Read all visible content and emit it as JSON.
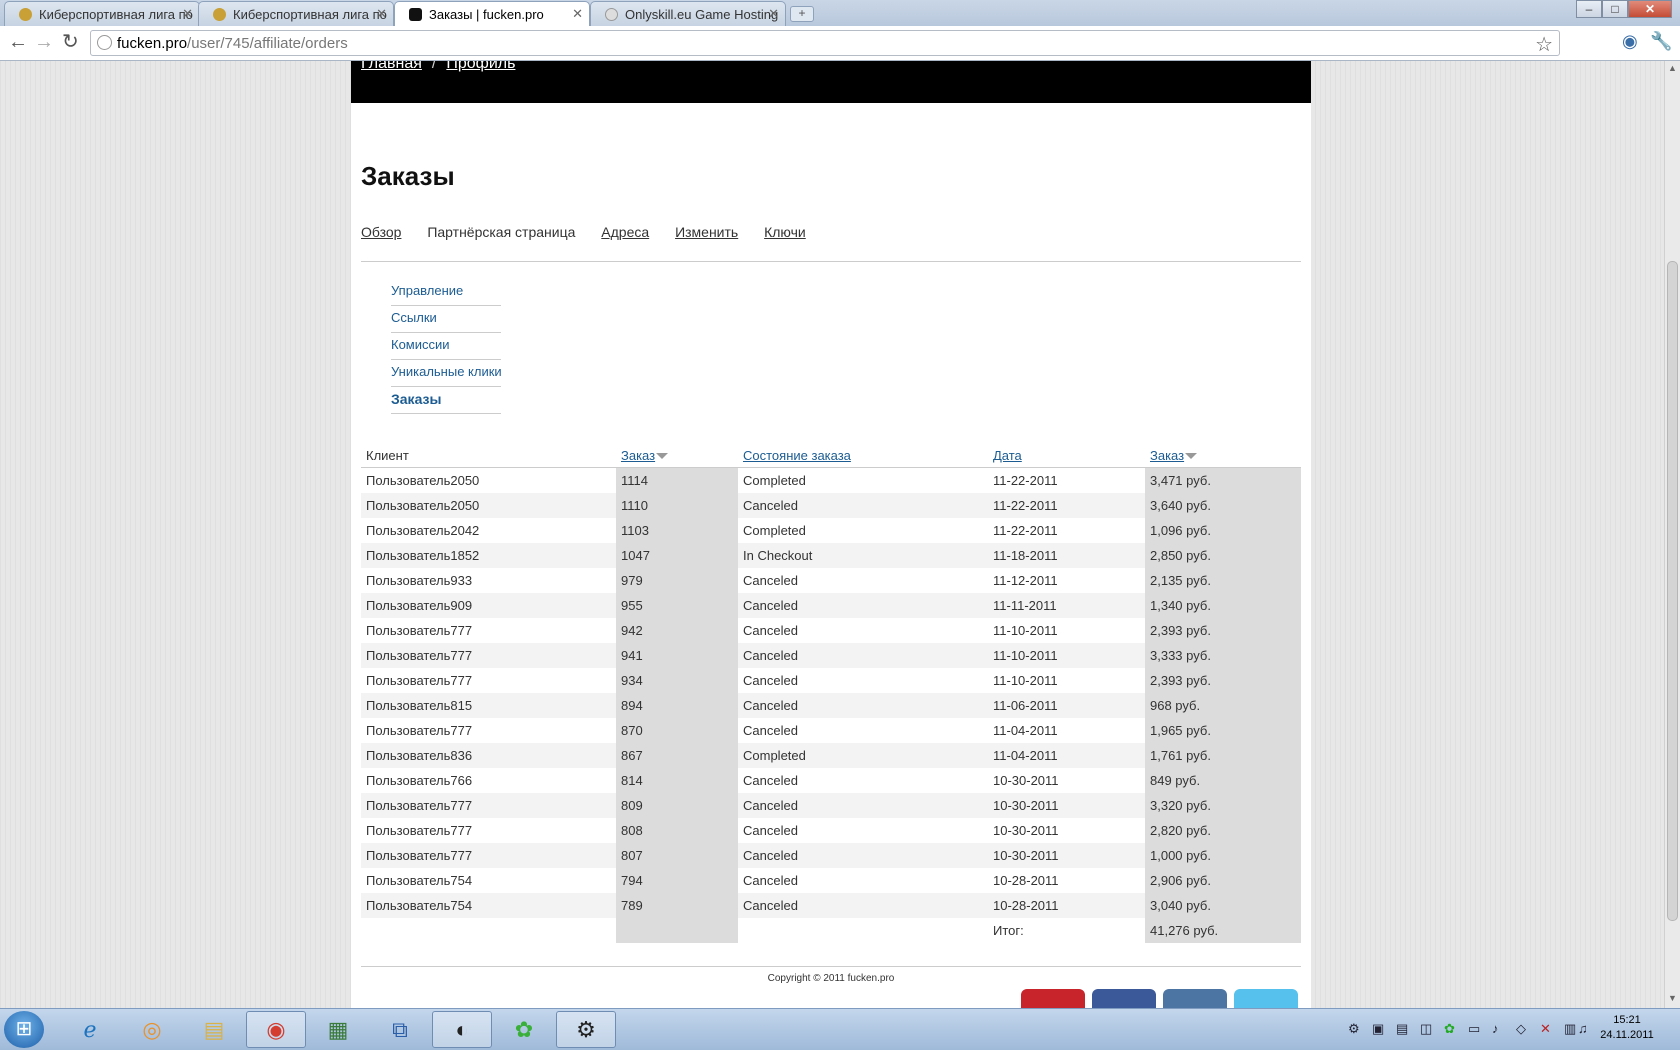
{
  "browser": {
    "tabs": [
      {
        "title": "Киберспортивная лига по"
      },
      {
        "title": "Киберспортивная лига по"
      },
      {
        "title": "Заказы | fucken.pro"
      },
      {
        "title": "Onlyskill.eu Game Hosting"
      }
    ],
    "new_tab": "+",
    "url_host": "fucken.pro",
    "url_path": "/user/745/affiliate/orders"
  },
  "breadcrumb": {
    "home": "Главная",
    "profile": "Профиль"
  },
  "page": {
    "title": "Заказы",
    "tabs": [
      "Обзор",
      "Партнёрская страница",
      "Адреса",
      "Изменить",
      "Ключи"
    ]
  },
  "subnav": [
    "Управление",
    "Ссылки",
    "Комиссии",
    "Уникальные клики",
    "Заказы"
  ],
  "table": {
    "headers": {
      "client": "Клиент",
      "order": "Заказ",
      "status": "Состояние заказа",
      "date": "Дата",
      "amount": "Заказ"
    },
    "rows": [
      {
        "client": "Пользователь2050",
        "order": "1114",
        "status": "Completed",
        "date": "11-22-2011",
        "amount": "3,471 руб."
      },
      {
        "client": "Пользователь2050",
        "order": "1110",
        "status": "Canceled",
        "date": "11-22-2011",
        "amount": "3,640 руб."
      },
      {
        "client": "Пользователь2042",
        "order": "1103",
        "status": "Completed",
        "date": "11-22-2011",
        "amount": "1,096 руб."
      },
      {
        "client": "Пользователь1852",
        "order": "1047",
        "status": "In Checkout",
        "date": "11-18-2011",
        "amount": "2,850 руб."
      },
      {
        "client": "Пользователь933",
        "order": "979",
        "status": "Canceled",
        "date": "11-12-2011",
        "amount": "2,135 руб."
      },
      {
        "client": "Пользователь909",
        "order": "955",
        "status": "Canceled",
        "date": "11-11-2011",
        "amount": "1,340 руб."
      },
      {
        "client": "Пользователь777",
        "order": "942",
        "status": "Canceled",
        "date": "11-10-2011",
        "amount": "2,393 руб."
      },
      {
        "client": "Пользователь777",
        "order": "941",
        "status": "Canceled",
        "date": "11-10-2011",
        "amount": "3,333 руб."
      },
      {
        "client": "Пользователь777",
        "order": "934",
        "status": "Canceled",
        "date": "11-10-2011",
        "amount": "2,393 руб."
      },
      {
        "client": "Пользователь815",
        "order": "894",
        "status": "Canceled",
        "date": "11-06-2011",
        "amount": "968 руб."
      },
      {
        "client": "Пользователь777",
        "order": "870",
        "status": "Canceled",
        "date": "11-04-2011",
        "amount": "1,965 руб."
      },
      {
        "client": "Пользователь836",
        "order": "867",
        "status": "Completed",
        "date": "11-04-2011",
        "amount": "1,761 руб."
      },
      {
        "client": "Пользователь766",
        "order": "814",
        "status": "Canceled",
        "date": "10-30-2011",
        "amount": "849 руб."
      },
      {
        "client": "Пользователь777",
        "order": "809",
        "status": "Canceled",
        "date": "10-30-2011",
        "amount": "3,320 руб."
      },
      {
        "client": "Пользователь777",
        "order": "808",
        "status": "Canceled",
        "date": "10-30-2011",
        "amount": "2,820 руб."
      },
      {
        "client": "Пользователь777",
        "order": "807",
        "status": "Canceled",
        "date": "10-30-2011",
        "amount": "1,000 руб."
      },
      {
        "client": "Пользователь754",
        "order": "794",
        "status": "Canceled",
        "date": "10-28-2011",
        "amount": "2,906 руб."
      },
      {
        "client": "Пользователь754",
        "order": "789",
        "status": "Canceled",
        "date": "10-28-2011",
        "amount": "3,040 руб."
      }
    ],
    "total_label": "Итог:",
    "total_value": "41,276 руб."
  },
  "footer": {
    "copyright": "Copyright © 2011 fucken.pro"
  },
  "taskbar": {
    "time": "15:21",
    "date": "24.11.2011"
  },
  "colors": {
    "link": "#1c5c92",
    "header": "#000000",
    "sorted_column": "#dcdcdc"
  }
}
